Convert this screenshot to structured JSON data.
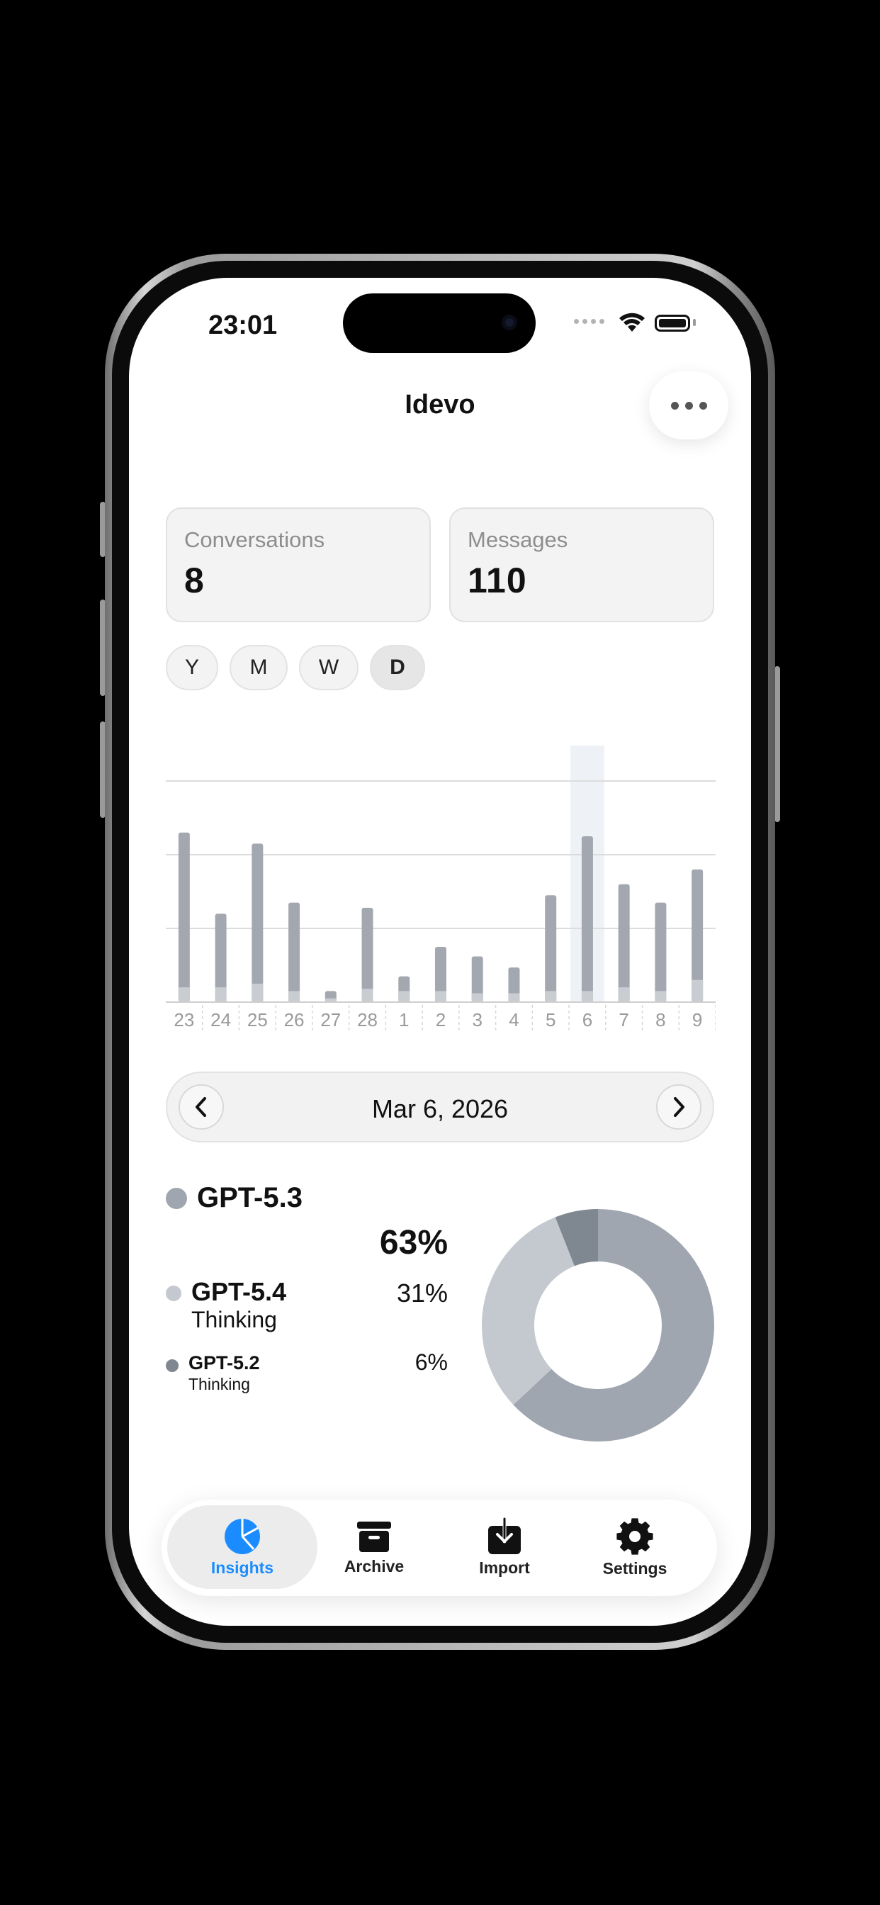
{
  "status_bar": {
    "time": "23:01"
  },
  "header": {
    "title": "Idevo"
  },
  "stats": [
    {
      "label": "Conversations",
      "value": "8"
    },
    {
      "label": "Messages",
      "value": "110"
    }
  ],
  "range_buttons": [
    "Y",
    "M",
    "W",
    "D"
  ],
  "active_range": "D",
  "chart_data": {
    "type": "bar",
    "categories": [
      "23",
      "24",
      "25",
      "26",
      "27",
      "28",
      "1",
      "2",
      "3",
      "4",
      "5",
      "6",
      "7",
      "8",
      "9"
    ],
    "series": [
      {
        "values": [
          2.1,
          1.0,
          1.9,
          1.2,
          0.1,
          1.1,
          0.2,
          0.6,
          0.5,
          0.35,
          1.3,
          2.1,
          1.4,
          1.2,
          1.5
        ]
      },
      {
        "values": [
          0.2,
          0.2,
          0.25,
          0.15,
          0.05,
          0.18,
          0.15,
          0.15,
          0.12,
          0.12,
          0.15,
          0.15,
          0.2,
          0.15,
          0.3
        ]
      }
    ],
    "ylim": [
      0,
      3
    ],
    "grid": true,
    "highlighted_category": "6",
    "colors": {
      "primary": "#a3a8b0",
      "secondary": "#c9cdd2",
      "highlight": "#eef1f5"
    }
  },
  "date_nav": {
    "label": "Mar 6, 2026"
  },
  "models": [
    {
      "name": "GPT-5.3",
      "sub": "",
      "percent": "63%",
      "share": 63,
      "color": "#a0a6af"
    },
    {
      "name": "GPT-5.4",
      "sub": "Thinking",
      "percent": "31%",
      "share": 31,
      "color": "#c4c9cf"
    },
    {
      "name": "GPT-5.2",
      "sub": "Thinking",
      "percent": "6%",
      "share": 6,
      "color": "#7f8891"
    }
  ],
  "tabs": [
    {
      "label": "Insights",
      "icon": "pie-chart-icon",
      "active": true
    },
    {
      "label": "Archive",
      "icon": "archive-box-icon",
      "active": false
    },
    {
      "label": "Import",
      "icon": "import-tray-icon",
      "active": false
    },
    {
      "label": "Settings",
      "icon": "gear-icon",
      "active": false
    }
  ],
  "colors": {
    "accent": "#1a8cff"
  }
}
